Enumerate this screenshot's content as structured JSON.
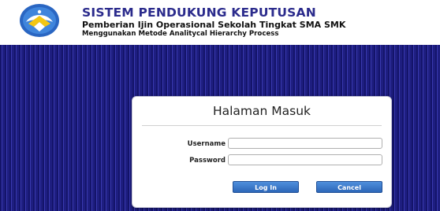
{
  "header": {
    "title": "SISTEM PENDUKUNG KEPUTUSAN",
    "subtitle": "Pemberian Ijin Operasional Sekolah Tingkat SMA SMK",
    "subtitle2": "Menggunakan Metode Analitycal Hierarchy Process",
    "logo_icon": "education-emblem-icon"
  },
  "login": {
    "title": "Halaman Masuk",
    "username_label": "Username",
    "username_value": "",
    "password_label": "Password",
    "password_value": "",
    "login_button": "Log In",
    "cancel_button": "Cancel"
  },
  "colors": {
    "title": "#2b2b8c",
    "band": "#1b1b7a",
    "button": "#3a78c9"
  }
}
